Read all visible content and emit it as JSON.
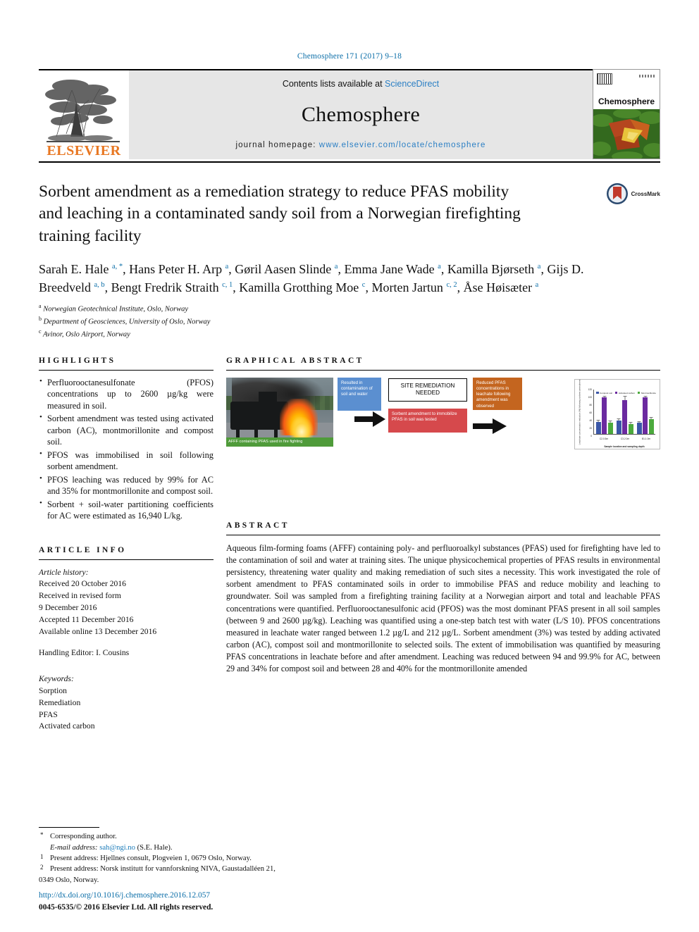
{
  "running_head": "Chemosphere 171 (2017) 9–18",
  "masthead": {
    "contents_prefix": "Contents lists available at",
    "contents_link": "ScienceDirect",
    "journal_name": "Chemosphere",
    "homepage_prefix": "journal homepage:",
    "homepage_link": "www.elsevier.com/locate/chemosphere",
    "publisher": "ELSEVIER",
    "cover_title": "Chemosphere",
    "brand_orange": "#E87722",
    "link_blue": "#2b7fc4"
  },
  "article": {
    "title": "Sorbent amendment as a remediation strategy to reduce PFAS mobility and leaching in a contaminated sandy soil from a Norwegian firefighting training facility",
    "crossmark_label": "CrossMark",
    "authors_html": "Sarah E. Hale <sup>a, *</sup>, Hans Peter H. Arp <sup>a</sup>, Gøril Aasen Slinde <sup>a</sup>, Emma Jane Wade <sup>a</sup>, Kamilla Bjørseth <sup>a</sup>, Gijs D. Breedveld <sup>a, b</sup>, Bengt Fredrik Straith <sup>c, 1</sup>, Kamilla Grotthing Moe <sup>c</sup>, Morten Jartun <sup>c, 2</sup>, Åse Høisæter <sup>a</sup>",
    "affiliations": [
      {
        "mark": "a",
        "text": "Norwegian Geotechnical Institute, Oslo, Norway"
      },
      {
        "mark": "b",
        "text": "Department of Geosciences, University of Oslo, Norway"
      },
      {
        "mark": "c",
        "text": "Avinor, Oslo Airport, Norway"
      }
    ]
  },
  "highlights": {
    "heading": "HIGHLIGHTS",
    "items": [
      "Perfluorooctanesulfonate (PFOS) concentrations up to 2600 µg/kg were measured in soil.",
      "Sorbent amendment was tested using activated carbon (AC), montmorillonite and compost soil.",
      "PFOS was immobilised in soil following sorbent amendment.",
      "PFOS leaching was reduced by 99% for AC and 35% for montmorillonite and compost soil.",
      "Sorbent + soil-water partitioning coefficients for AC were estimated as 16,940 L/kg."
    ]
  },
  "article_info": {
    "heading": "ARTICLE INFO",
    "history_label": "Article history:",
    "history": [
      "Received 20 October 2016",
      "Received in revised form",
      "9 December 2016",
      "Accepted 11 December 2016",
      "Available online 13 December 2016"
    ],
    "handling_editor": "Handling Editor: I. Cousins",
    "keywords_label": "Keywords:",
    "keywords": [
      "Sorption",
      "Remediation",
      "PFAS",
      "Activated carbon"
    ]
  },
  "graphical_abstract": {
    "heading": "GRAPHICAL ABSTRACT",
    "photo_caption": "AFFF containing PFAS used in fire fighting",
    "blue_box": "Resulted in contamination of soil and water",
    "white_box": "SITE REMEDIATION NEEDED",
    "red_box": "Sorbent amendment to immobilize PFAS in soil was tested",
    "orange_box": "Reduced PFAS concentrations in leachate following amendment was observed",
    "colors": {
      "blue": "#5b8fd0",
      "red": "#d6494c",
      "orange": "#c4651f",
      "green_caption": "#4f9b3a"
    }
  },
  "chart_data": {
    "type": "bar",
    "title": "",
    "xlabel": "Sample location and sampling depth",
    "ylabel": "Leachate concentration reduction (%) following sorbent amendment",
    "categories": [
      "C2-0.5m",
      "C3-2.0m",
      "B1-1.0m"
    ],
    "ylim": [
      0,
      120
    ],
    "yticks": [
      0,
      20,
      40,
      60,
      80,
      100,
      120
    ],
    "grid": false,
    "legend_position": "top",
    "series": [
      {
        "name": "Compost soil",
        "color": "#3b57a8",
        "values": [
          32,
          36,
          29
        ]
      },
      {
        "name": "Activated carbon",
        "color": "#6b2aa0",
        "values": [
          99,
          91,
          99
        ]
      },
      {
        "name": "Montmorillonite",
        "color": "#4caa3d",
        "values": [
          30,
          27,
          40
        ]
      }
    ],
    "errors": [
      [
        4,
        3,
        2
      ],
      [
        2,
        9,
        2
      ],
      [
        4,
        2,
        3
      ]
    ]
  },
  "abstract": {
    "heading": "ABSTRACT",
    "text": "Aqueous film-forming foams (AFFF) containing poly- and perfluoroalkyl substances (PFAS) used for firefighting have led to the contamination of soil and water at training sites. The unique physicochemical properties of PFAS results in environmental persistency, threatening water quality and making remediation of such sites a necessity. This work investigated the role of sorbent amendment to PFAS contaminated soils in order to immobilise PFAS and reduce mobility and leaching to groundwater. Soil was sampled from a firefighting training facility at a Norwegian airport and total and leachable PFAS concentrations were quantified. Perfluorooctanesulfonic acid (PFOS) was the most dominant PFAS present in all soil samples (between 9 and 2600 µg/kg). Leaching was quantified using a one-step batch test with water (L/S 10). PFOS concentrations measured in leachate water ranged between 1.2 µg/L and 212 µg/L. Sorbent amendment (3%) was tested by adding activated carbon (AC), compost soil and montmorillonite to selected soils. The extent of immobilisation was quantified by measuring PFAS concentrations in leachate before and after amendment. Leaching was reduced between 94 and 99.9% for AC, between 29 and 34% for compost soil and between 28 and 40% for the montmorillonite amended"
  },
  "footnotes": {
    "corresponding": "Corresponding author.",
    "email_label": "E-mail address:",
    "email": "sah@ngi.no",
    "email_suffix": "(S.E. Hale).",
    "note1": "Present address: Hjellnes consult, Plogveien 1, 0679 Oslo, Norway.",
    "note2": "Present address: Norsk institutt for vannforskning NIVA, Gaustadalléen 21,",
    "note2_cont": "0349 Oslo, Norway."
  },
  "doi": {
    "url": "http://dx.doi.org/10.1016/j.chemosphere.2016.12.057",
    "copyright": "0045-6535/© 2016 Elsevier Ltd. All rights reserved."
  }
}
